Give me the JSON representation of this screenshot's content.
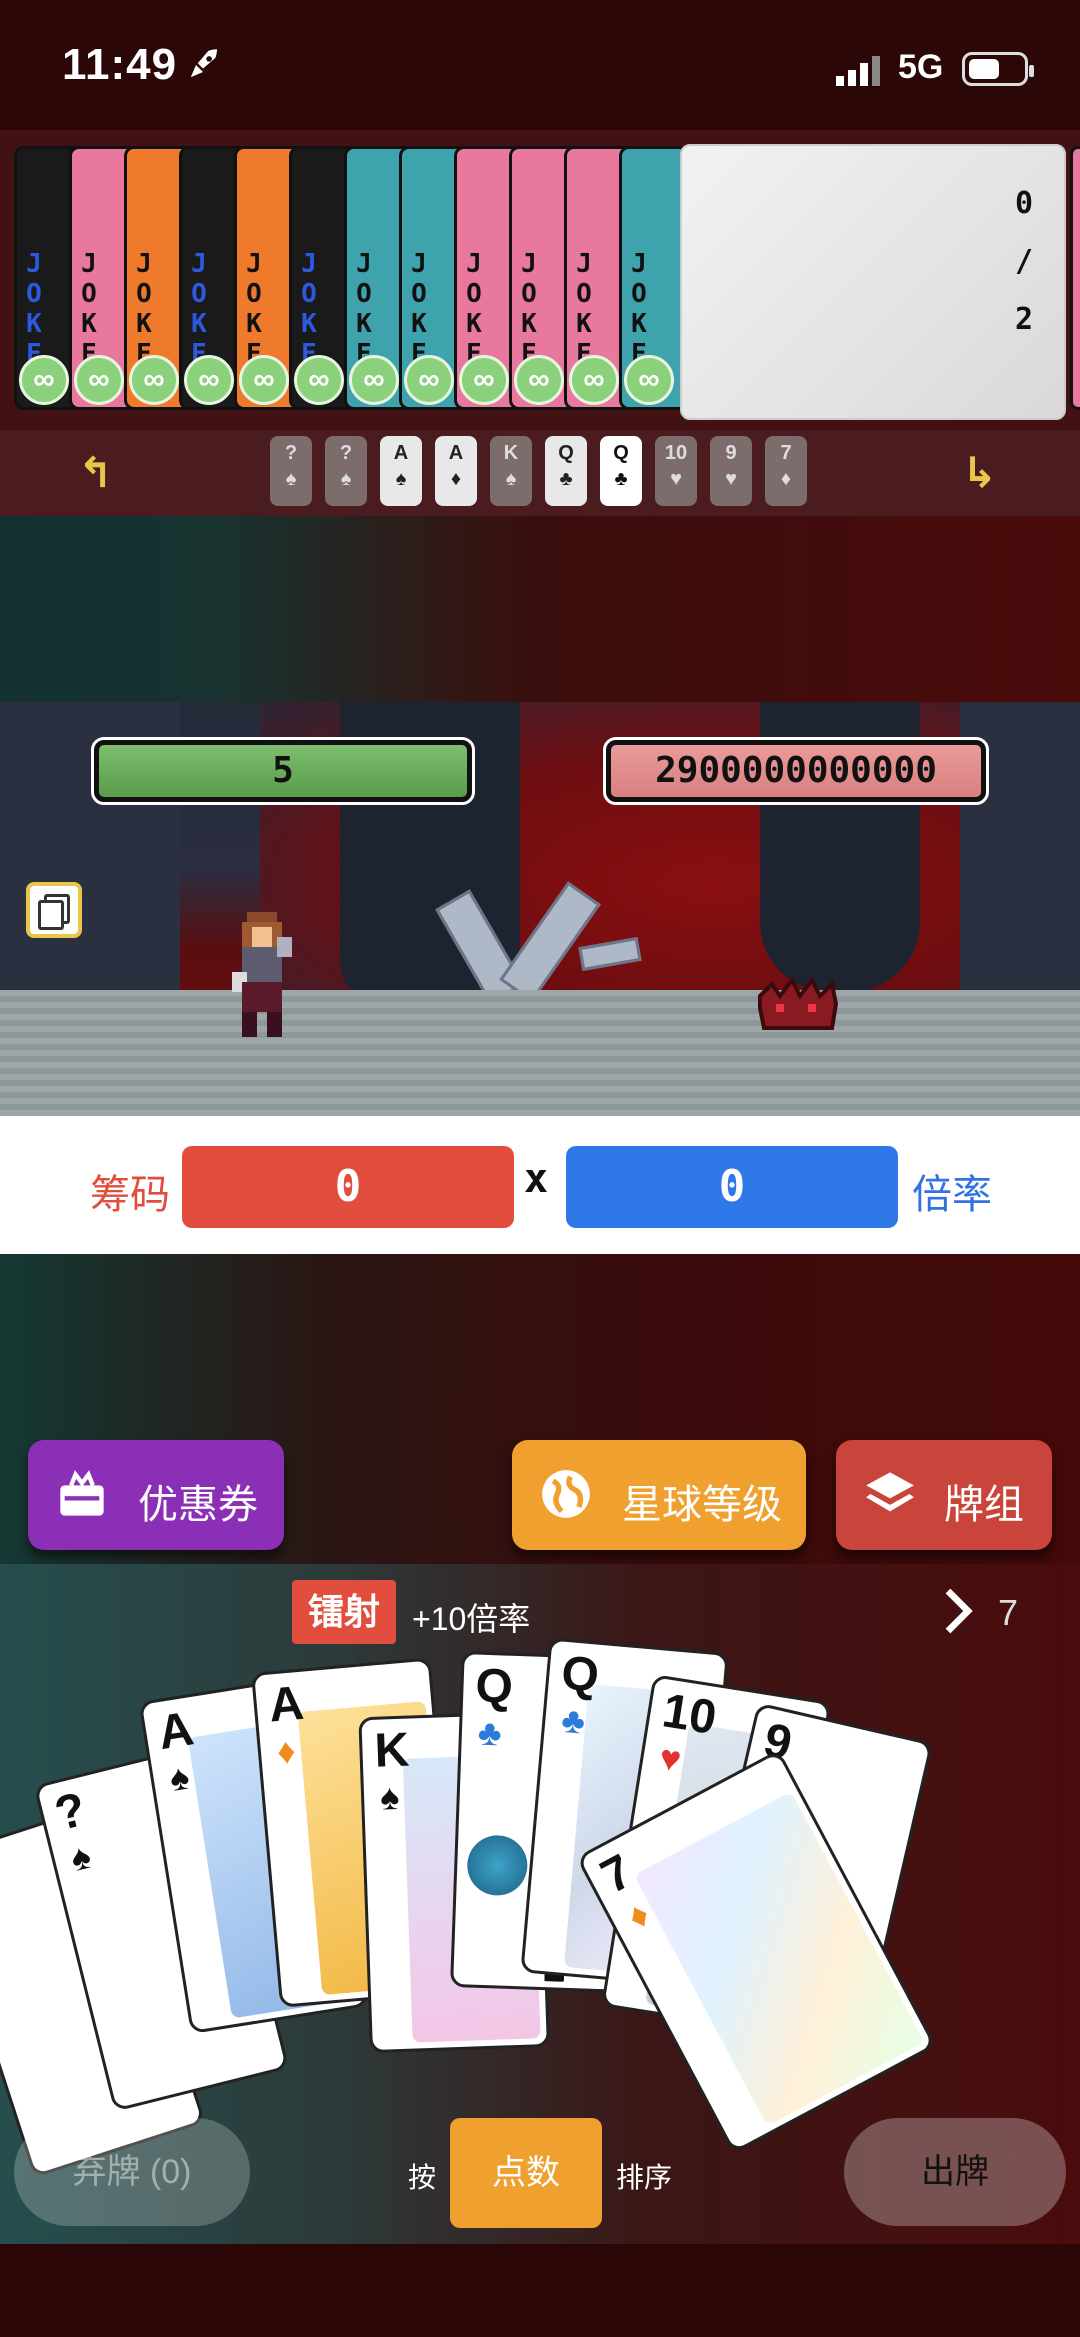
{
  "status": {
    "time": "11:49",
    "network": "5G"
  },
  "jokers": {
    "cards": [
      {
        "text": "JOKE",
        "color": "#1a1a1a",
        "badge": "∞"
      },
      {
        "text": "JOKE",
        "color": "#e8789e",
        "badge": "∞"
      },
      {
        "text": "JOKE",
        "color": "#ef7a2b",
        "badge": "∞"
      },
      {
        "text": "JOKE",
        "color": "#1a1a1a",
        "badge": "∞"
      },
      {
        "text": "JOKE",
        "color": "#ef7a2b",
        "badge": "∞"
      },
      {
        "text": "JOKE",
        "color": "#1a1a1a",
        "badge": "∞"
      },
      {
        "text": "JOKE",
        "color": "#3fa3ad",
        "badge": "∞"
      },
      {
        "text": "JOKE",
        "color": "#3fa3ad",
        "badge": "∞"
      },
      {
        "text": "JOKE",
        "color": "#e8789e",
        "badge": "∞"
      },
      {
        "text": "JOKE",
        "color": "#e8789e",
        "badge": "∞"
      },
      {
        "text": "JOKE",
        "color": "#e8789e",
        "badge": "∞"
      },
      {
        "text": "JOKE",
        "color": "#3fa3ad",
        "badge": "∞"
      }
    ],
    "detail": [
      "0",
      "/",
      "2"
    ]
  },
  "played": {
    "cards": [
      {
        "rank": "?",
        "suit": "♠",
        "state": "dim"
      },
      {
        "rank": "?",
        "suit": "♠",
        "state": "dim"
      },
      {
        "rank": "A",
        "suit": "♠",
        "state": "hi"
      },
      {
        "rank": "A",
        "suit": "♦",
        "state": "hi"
      },
      {
        "rank": "K",
        "suit": "♠",
        "state": "dim"
      },
      {
        "rank": "Q",
        "suit": "♣",
        "state": "hi"
      },
      {
        "rank": "Q",
        "suit": "♣",
        "state": "sel"
      },
      {
        "rank": "10",
        "suit": "♥",
        "state": "dim"
      },
      {
        "rank": "9",
        "suit": "♥",
        "state": "dim"
      },
      {
        "rank": "7",
        "suit": "♦",
        "state": "dim"
      }
    ]
  },
  "battle": {
    "player_hp": "5",
    "enemy_hp": "2900000000000"
  },
  "score": {
    "chips_label": "筹码",
    "chips_value": "0",
    "times": "x",
    "mult_value": "0",
    "mult_label": "倍率"
  },
  "buttons": {
    "coupon": "优惠券",
    "planet": "星球等级",
    "deck": "牌组"
  },
  "hand": {
    "edition_tag": "镭射",
    "edition_effect": "+10倍率",
    "count": "7",
    "cards": [
      {
        "rank": "?",
        "suit": "♠"
      },
      {
        "rank": "?",
        "suit": "♠"
      },
      {
        "rank": "A",
        "suit": "♠"
      },
      {
        "rank": "A",
        "suit": "♦"
      },
      {
        "rank": "K",
        "suit": "♠"
      },
      {
        "rank": "Q",
        "suit": "♣"
      },
      {
        "rank": "Q",
        "suit": "♣"
      },
      {
        "rank": "10",
        "suit": "♥"
      },
      {
        "rank": "9",
        "suit": "♥"
      },
      {
        "rank": "7",
        "suit": "♦"
      }
    ]
  },
  "controls": {
    "discard": "弃牌 (0)",
    "sort_prefix": "按",
    "sort_mode": "点数",
    "sort_suffix": "排序",
    "play": "出牌"
  }
}
